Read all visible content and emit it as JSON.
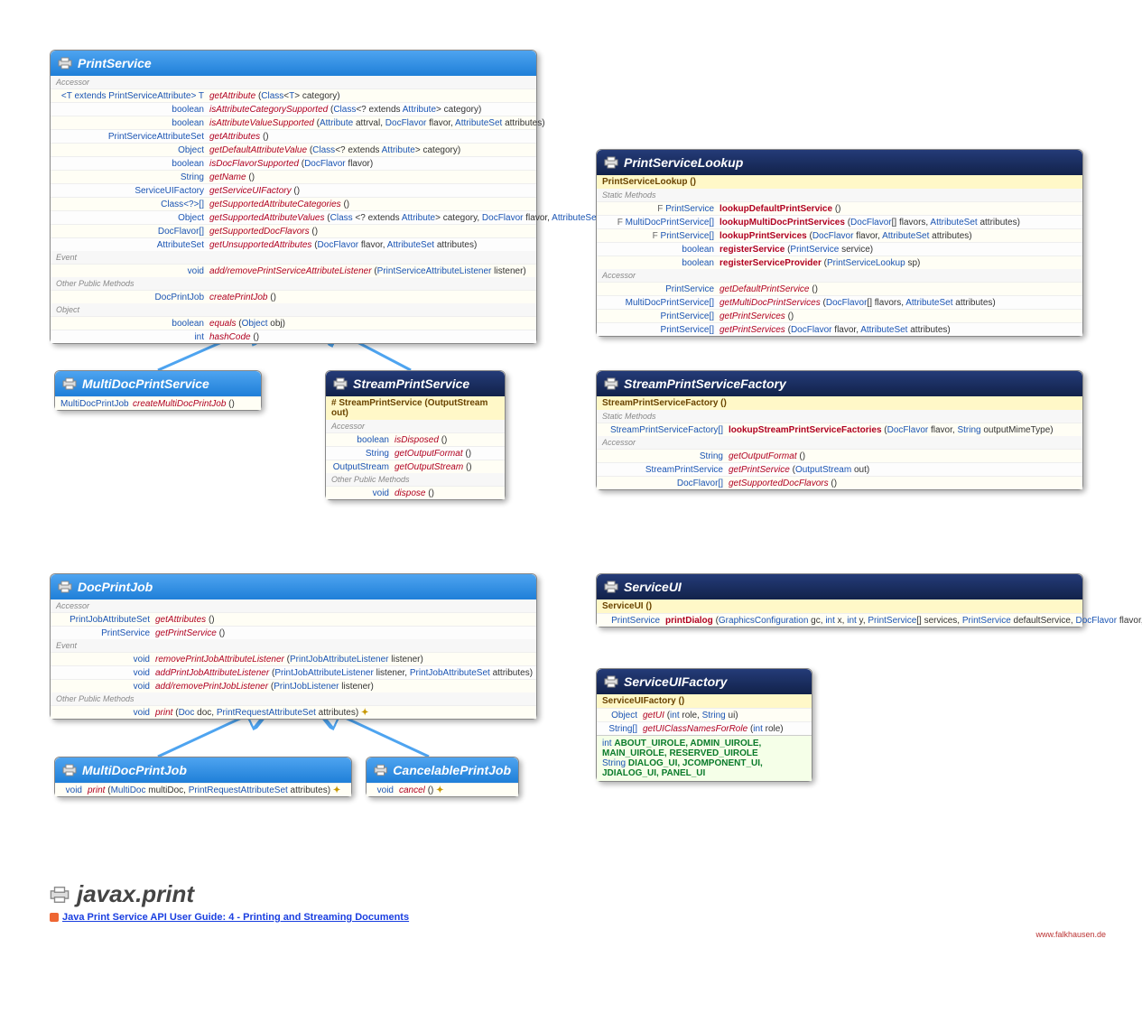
{
  "footer": {
    "package": "javax.print",
    "link": "Java Print Service API User Guide: 4 - Printing and Streaming Documents",
    "credit": "www.falkhausen.de"
  },
  "boxes": {
    "printservice": {
      "title": "PrintService",
      "sections": [
        {
          "label": "Accessor",
          "rows": [
            {
              "ret": "<T extends PrintServiceAttribute> T",
              "nm": "getAttribute",
              "args": "(Class<T> category)"
            },
            {
              "ret": "boolean",
              "nm": "isAttributeCategorySupported",
              "args": "(Class<? extends Attribute> category)"
            },
            {
              "ret": "boolean",
              "nm": "isAttributeValueSupported",
              "args": "(Attribute attrval, DocFlavor flavor, AttributeSet attributes)"
            },
            {
              "ret": "PrintServiceAttributeSet",
              "nm": "getAttributes",
              "args": "()"
            },
            {
              "ret": "Object",
              "nm": "getDefaultAttributeValue",
              "args": "(Class<? extends Attribute> category)"
            },
            {
              "ret": "boolean",
              "nm": "isDocFlavorSupported",
              "args": "(DocFlavor flavor)"
            },
            {
              "ret": "String",
              "nm": "getName",
              "args": "()"
            },
            {
              "ret": "ServiceUIFactory",
              "nm": "getServiceUIFactory",
              "args": "()"
            },
            {
              "ret": "Class<?>[]",
              "nm": "getSupportedAttributeCategories",
              "args": "()"
            },
            {
              "ret": "Object",
              "nm": "getSupportedAttributeValues",
              "args": "(Class <? extends Attribute> category, DocFlavor flavor, AttributeSet attributes)"
            },
            {
              "ret": "DocFlavor[]",
              "nm": "getSupportedDocFlavors",
              "args": "()"
            },
            {
              "ret": "AttributeSet",
              "nm": "getUnsupportedAttributes",
              "args": "(DocFlavor flavor, AttributeSet attributes)"
            }
          ]
        },
        {
          "label": "Event",
          "rows": [
            {
              "ret": "void",
              "nm": "add/removePrintServiceAttributeListener",
              "args": "(PrintServiceAttributeListener listener)"
            }
          ]
        },
        {
          "label": "Other Public Methods",
          "rows": [
            {
              "ret": "DocPrintJob",
              "nm": "createPrintJob",
              "args": "()"
            }
          ]
        },
        {
          "label": "Object",
          "rows": [
            {
              "ret": "boolean",
              "nm": "equals",
              "args": "(Object obj)"
            },
            {
              "ret": "int",
              "nm": "hashCode",
              "args": "()"
            }
          ]
        }
      ]
    },
    "multidocprintservice": {
      "title": "MultiDocPrintService",
      "rows": [
        {
          "ret": "MultiDocPrintJob",
          "nm": "createMultiDocPrintJob",
          "args": "()"
        }
      ]
    },
    "streamprintservice": {
      "title": "StreamPrintService",
      "ctor": "# StreamPrintService (OutputStream out)",
      "sections": [
        {
          "label": "Accessor",
          "rows": [
            {
              "ret": "boolean",
              "nm": "isDisposed",
              "args": "()"
            },
            {
              "ret": "String",
              "nm": "getOutputFormat",
              "args": "()"
            },
            {
              "ret": "OutputStream",
              "nm": "getOutputStream",
              "args": "()"
            }
          ]
        },
        {
          "label": "Other Public Methods",
          "rows": [
            {
              "ret": "void",
              "nm": "dispose",
              "args": "()"
            }
          ]
        }
      ]
    },
    "printservicelookup": {
      "title": "PrintServiceLookup",
      "ctor": "PrintServiceLookup ()",
      "sections": [
        {
          "label": "Static Methods",
          "rows": [
            {
              "ret": "PrintService",
              "nm": "lookupDefaultPrintService",
              "args": "()",
              "static": true,
              "final": true
            },
            {
              "ret": "MultiDocPrintService[]",
              "nm": "lookupMultiDocPrintServices",
              "args": "(DocFlavor[] flavors, AttributeSet attributes)",
              "static": true,
              "final": true
            },
            {
              "ret": "PrintService[]",
              "nm": "lookupPrintServices",
              "args": "(DocFlavor flavor, AttributeSet attributes)",
              "static": true,
              "final": true
            },
            {
              "ret": "boolean",
              "nm": "registerService",
              "args": "(PrintService service)",
              "static": true
            },
            {
              "ret": "boolean",
              "nm": "registerServiceProvider",
              "args": "(PrintServiceLookup sp)",
              "static": true
            }
          ]
        },
        {
          "label": "Accessor",
          "rows": [
            {
              "ret": "PrintService",
              "nm": "getDefaultPrintService",
              "args": "()"
            },
            {
              "ret": "MultiDocPrintService[]",
              "nm": "getMultiDocPrintServices",
              "args": "(DocFlavor[] flavors, AttributeSet attributes)"
            },
            {
              "ret": "PrintService[]",
              "nm": "getPrintServices",
              "args": "()"
            },
            {
              "ret": "PrintService[]",
              "nm": "getPrintServices",
              "args": "(DocFlavor flavor, AttributeSet attributes)"
            }
          ]
        }
      ]
    },
    "streamprintservicefactory": {
      "title": "StreamPrintServiceFactory",
      "ctor": "StreamPrintServiceFactory ()",
      "sections": [
        {
          "label": "Static Methods",
          "rows": [
            {
              "ret": "StreamPrintServiceFactory[]",
              "nm": "lookupStreamPrintServiceFactories",
              "args": "(DocFlavor flavor, String outputMimeType)",
              "static": true
            }
          ]
        },
        {
          "label": "Accessor",
          "rows": [
            {
              "ret": "String",
              "nm": "getOutputFormat",
              "args": "()"
            },
            {
              "ret": "StreamPrintService",
              "nm": "getPrintService",
              "args": "(OutputStream out)"
            },
            {
              "ret": "DocFlavor[]",
              "nm": "getSupportedDocFlavors",
              "args": "()"
            }
          ]
        }
      ]
    },
    "docprintjob": {
      "title": "DocPrintJob",
      "sections": [
        {
          "label": "Accessor",
          "rows": [
            {
              "ret": "PrintJobAttributeSet",
              "nm": "getAttributes",
              "args": "()"
            },
            {
              "ret": "PrintService",
              "nm": "getPrintService",
              "args": "()"
            }
          ]
        },
        {
          "label": "Event",
          "rows": [
            {
              "ret": "void",
              "nm": "removePrintJobAttributeListener",
              "args": "(PrintJobAttributeListener listener)"
            },
            {
              "ret": "void",
              "nm": "addPrintJobAttributeListener",
              "args": "(PrintJobAttributeListener listener, PrintJobAttributeSet attributes)"
            },
            {
              "ret": "void",
              "nm": "add/removePrintJobListener",
              "args": "(PrintJobListener listener)"
            }
          ]
        },
        {
          "label": "Other Public Methods",
          "rows": [
            {
              "ret": "void",
              "nm": "print",
              "args": "(Doc doc, PrintRequestAttributeSet attributes)",
              "exc": true
            }
          ]
        }
      ]
    },
    "multidocprintjob": {
      "title": "MultiDocPrintJob",
      "rows": [
        {
          "ret": "void",
          "nm": "print",
          "args": "(MultiDoc multiDoc, PrintRequestAttributeSet attributes)",
          "exc": true
        }
      ]
    },
    "cancelableprintjob": {
      "title": "CancelablePrintJob",
      "rows": [
        {
          "ret": "void",
          "nm": "cancel",
          "args": "()",
          "exc": true
        }
      ]
    },
    "serviceui": {
      "title": "ServiceUI",
      "ctor": "ServiceUI ()",
      "rows": [
        {
          "ret": "PrintService",
          "nm": "printDialog",
          "args": "(GraphicsConfiguration gc, int x, int y, PrintService[] services, PrintService defaultService, DocFlavor flavor, PrintRequestAttributeSet attributes)",
          "static": true,
          "exc": true
        }
      ]
    },
    "serviceuifactory": {
      "title": "ServiceUIFactory",
      "ctor": "ServiceUIFactory ()",
      "rows": [
        {
          "ret": "Object",
          "nm": "getUI",
          "args": "(int role, String ui)"
        },
        {
          "ret": "String[]",
          "nm": "getUIClassNamesForRole",
          "args": "(int role)"
        }
      ],
      "consts": [
        {
          "t": "int",
          "v": "ABOUT_UIROLE, ADMIN_UIROLE, MAIN_UIROLE, RESERVED_UIROLE"
        },
        {
          "t": "String",
          "v": "DIALOG_UI, JCOMPONENT_UI, JDIALOG_UI, PANEL_UI"
        }
      ]
    }
  }
}
